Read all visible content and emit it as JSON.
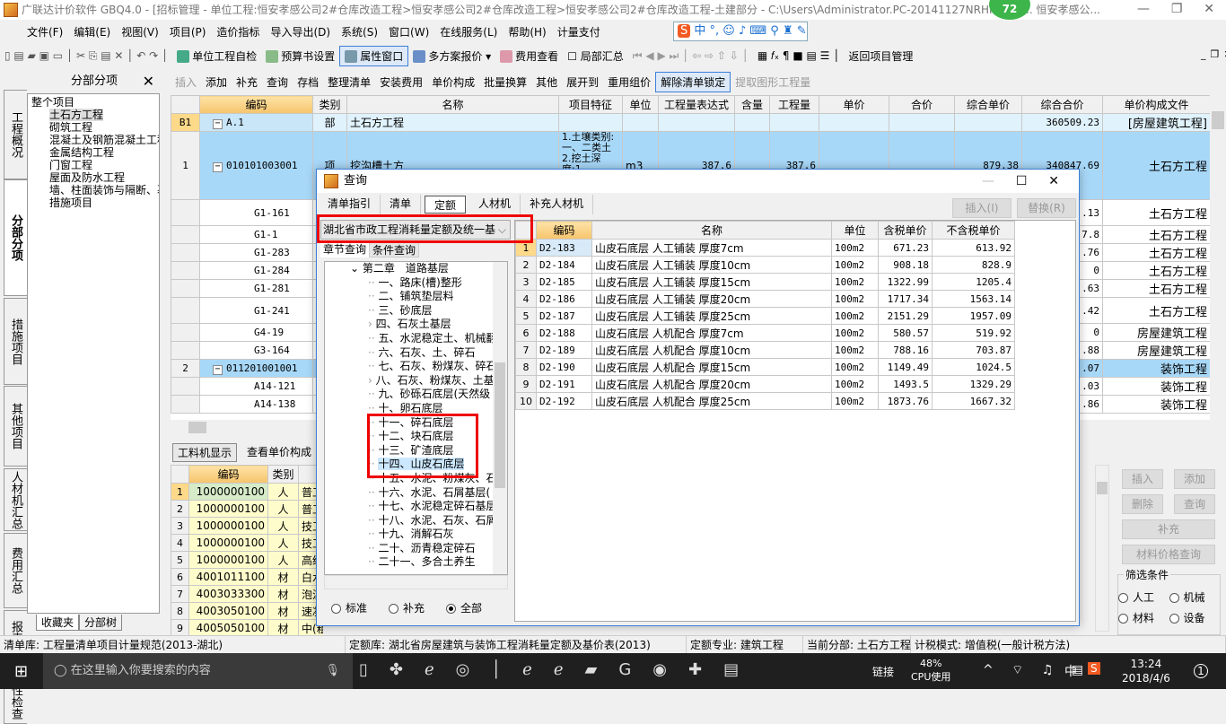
{
  "window": {
    "title": "广联达计价软件 GBQ4.0 - [招标管理 - 单位工程:恒安孝感公司2#仓库改造工程>恒安孝感公司2#仓库改造工程>恒安孝感公司2#仓库改造工程-土建部分 - C:\\Users\\Administrator.PC-20141127NRHM\\Des... 恒安孝感公...",
    "badge": "72"
  },
  "menu": [
    "文件(F)",
    "编辑(E)",
    "视图(V)",
    "项目(P)",
    "造价指标",
    "导入导出(D)",
    "系统(S)",
    "窗口(W)",
    "在线服务(L)",
    "帮助(H)",
    "计量支付"
  ],
  "toolbar1": {
    "self_check": "单位工程自检",
    "budget_settings": "预算书设置",
    "property_window": "属性窗口",
    "multi_quote": "多方案报价",
    "fee_view": "费用查看",
    "partial_summary": "局部汇总",
    "back_project": "返回项目管理"
  },
  "toolbar2": [
    "插入",
    "添加",
    "补充",
    "查询",
    "存档",
    "整理清单",
    "安装费用",
    "单价构成",
    "批量换算",
    "其他",
    "展开到",
    "重用组价",
    "解除清单锁定",
    "提取图形工程量"
  ],
  "vtabs": [
    "工程概况",
    "分部分项",
    "措施项目",
    "其他项目",
    "人材机汇总",
    "费用汇总",
    "报表",
    "符合性检查"
  ],
  "left_panel": {
    "title": "分部分项",
    "tree_root": "整个项目",
    "tree": [
      "土石方工程",
      "砌筑工程",
      "混凝土及钢筋混凝土工程",
      "金属结构工程",
      "门窗工程",
      "屋面及防水工程",
      "墙、柱面装饰与隔断、幕",
      "措施项目"
    ],
    "bottom_tabs": [
      "收藏夹",
      "分部树"
    ]
  },
  "main_grid": {
    "columns": [
      "编码",
      "类别",
      "名称",
      "项目特征",
      "单位",
      "工程量表达式",
      "含量",
      "工程量",
      "单价",
      "合价",
      "综合单价",
      "综合合价",
      "单价构成文件"
    ],
    "rows": [
      {
        "no": "B1",
        "code": "A.1",
        "type": "部",
        "name": "土石方工程",
        "feature": "",
        "unit": "",
        "expr": "",
        "qty": "",
        "comp_price": "",
        "comp_total": "360509.23",
        "file": "[房屋建筑工程]"
      },
      {
        "no": "1",
        "code": "010101003001",
        "type": "项",
        "name": "挖沟槽土方",
        "feature": "1.土壤类别:一、二类土 2.挖土深度:1",
        "unit": "m3",
        "expr": "387.6",
        "qty": "387.6",
        "comp_price": "879.38",
        "comp_total": "340847.69",
        "file": "土石方工程"
      },
      {
        "no": "",
        "code": "G1-161",
        "comp_total": ".13",
        "file": "土石方工程"
      },
      {
        "no": "",
        "code": "G1-1",
        "comp_total": "7.8",
        "file": "土石方工程"
      },
      {
        "no": "",
        "code": "G1-283",
        "comp_total": ".76",
        "file": "土石方工程"
      },
      {
        "no": "",
        "code": "G1-284",
        "comp_total": "0",
        "file": "土石方工程"
      },
      {
        "no": "",
        "code": "G1-281",
        "comp_total": ".63",
        "file": "土石方工程"
      },
      {
        "no": "",
        "code": "G1-241",
        "comp_total": ".42",
        "file": "土石方工程"
      },
      {
        "no": "",
        "code": "G4-19",
        "comp_total": "0",
        "file": "房屋建筑工程"
      },
      {
        "no": "",
        "code": "G3-164",
        "comp_total": ".88",
        "file": "房屋建筑工程"
      },
      {
        "no": "2",
        "code": "011201001001",
        "comp_total": ".07",
        "file": "装饰工程"
      },
      {
        "no": "",
        "code": "A14-121",
        "comp_total": ".03",
        "file": "装饰工程"
      },
      {
        "no": "",
        "code": "A14-138",
        "comp_total": ".86",
        "file": "装饰工程"
      }
    ]
  },
  "lower": {
    "tabs": [
      "工料机显示",
      "查看单价构成"
    ],
    "columns": [
      "编码",
      "类别",
      "名称"
    ],
    "rows": [
      [
        "1000000100",
        "人",
        "普工"
      ],
      [
        "1000000100",
        "人",
        "普工"
      ],
      [
        "1000000100",
        "人",
        "技工"
      ],
      [
        "1000000100",
        "人",
        "技工"
      ],
      [
        "1000000100",
        "人",
        "高级"
      ],
      [
        "4001011100",
        "材",
        "白水"
      ],
      [
        "4003033300",
        "材",
        "泡沫"
      ],
      [
        "4003050100",
        "材",
        "速凝"
      ],
      [
        "4005050100",
        "材",
        "中(粗)"
      ]
    ],
    "buttons": [
      "插入",
      "添加",
      "删除",
      "查询",
      "补充",
      "材料价格查询"
    ],
    "filter_title": "筛选条件",
    "filters": [
      "人工",
      "机械",
      "材料",
      "设备"
    ]
  },
  "dialog": {
    "title": "查询",
    "tabs": [
      "清单指引",
      "清单",
      "定额",
      "人材机",
      "补充人材机"
    ],
    "active_tab": "定额",
    "insert": "插入(I)",
    "replace": "替换(R)",
    "library": "湖北省市政工程消耗量定额及统一基",
    "subtabs": [
      "章节查询",
      "条件查询"
    ],
    "chapter": "第二章　道路基层",
    "tree": [
      "一、路床(槽)整形",
      "二、铺筑垫层料",
      "三、砂底层",
      "四、石灰土基层",
      "五、水泥稳定土、机械翻",
      "六、石灰、土、碎石",
      "七、石灰、粉煤灰、碎石",
      "八、石灰、粉煤灰、土基",
      "九、砂砾石底层(天然级",
      "十、卵石底层",
      "十一、碎石底层",
      "十二、块石底层",
      "十三、矿渣底层",
      "十四、山皮石底层",
      "十五、水泥、粉煤灰、石",
      "十六、水泥、石屑基层(",
      "十七、水泥稳定碎石基层",
      "十八、水泥、石灰、石屑",
      "十九、消解石灰",
      "二十、沥青稳定碎石",
      "二十一、多合土养生"
    ],
    "selected_node": "十四、山皮石底层",
    "radios": [
      "标准",
      "补充",
      "全部"
    ],
    "radio_selected": "全部",
    "columns": [
      "编码",
      "名称",
      "单位",
      "含税单价",
      "不含税单价"
    ],
    "rows": [
      [
        "D2-183",
        "山皮石底层 人工铺装 厚度7cm",
        "100m2",
        "671.23",
        "613.92"
      ],
      [
        "D2-184",
        "山皮石底层 人工铺装 厚度10cm",
        "100m2",
        "908.18",
        "828.9"
      ],
      [
        "D2-185",
        "山皮石底层 人工铺装 厚度15cm",
        "100m2",
        "1322.99",
        "1205.4"
      ],
      [
        "D2-186",
        "山皮石底层 人工铺装 厚度20cm",
        "100m2",
        "1717.34",
        "1563.14"
      ],
      [
        "D2-187",
        "山皮石底层 人工铺装 厚度25cm",
        "100m2",
        "2151.29",
        "1957.09"
      ],
      [
        "D2-188",
        "山皮石底层 人机配合 厚度7cm",
        "100m2",
        "580.57",
        "519.92"
      ],
      [
        "D2-189",
        "山皮石底层 人机配合 厚度10cm",
        "100m2",
        "788.16",
        "703.87"
      ],
      [
        "D2-190",
        "山皮石底层 人机配合 厚度15cm",
        "100m2",
        "1149.49",
        "1024.5"
      ],
      [
        "D2-191",
        "山皮石底层 人机配合 厚度20cm",
        "100m2",
        "1493.5",
        "1329.29"
      ],
      [
        "D2-192",
        "山皮石底层 人机配合 厚度25cm",
        "100m2",
        "1873.76",
        "1667.32"
      ]
    ]
  },
  "status": [
    "清单库: 工程量清单项目计量规范(2013-湖北)",
    "定额库: 湖北省房屋建筑与装饰工程消耗量定额及基价表(2013)",
    "定额专业: 建筑工程",
    "当前分部: 土石方工程",
    "计税模式: 增值税(一般计税方法)"
  ],
  "taskbar": {
    "search_placeholder": "在这里输入你要搜索的内容",
    "link": "链接",
    "cpu": "48%",
    "cpu_label": "CPU使用",
    "ime": "中",
    "time": "13:24",
    "date": "2018/4/6",
    "notifications": "1"
  },
  "colors": {
    "accent": "#3c7fd8",
    "header_highlight": "#f6c46c",
    "selected_row": "#a8d8f8",
    "annotation": "#e00000"
  }
}
